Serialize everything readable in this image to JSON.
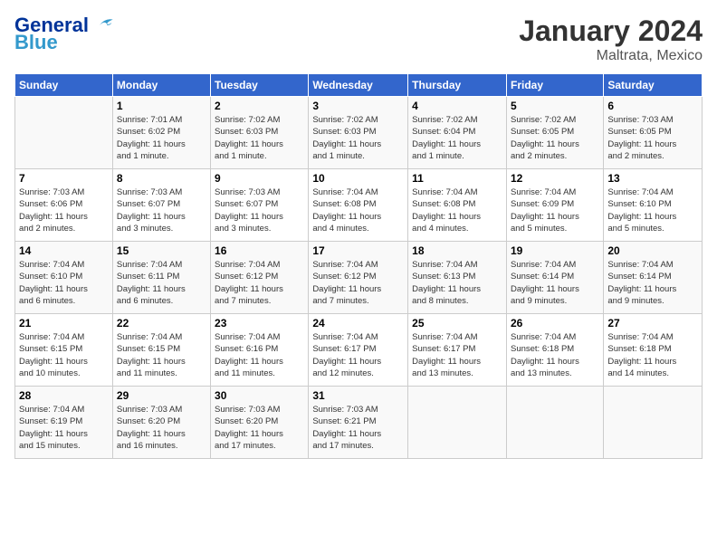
{
  "header": {
    "logo_line1": "General",
    "logo_line2": "Blue",
    "month_title": "January 2024",
    "location": "Maltrata, Mexico"
  },
  "weekdays": [
    "Sunday",
    "Monday",
    "Tuesday",
    "Wednesday",
    "Thursday",
    "Friday",
    "Saturday"
  ],
  "weeks": [
    [
      {
        "day": "",
        "info": ""
      },
      {
        "day": "1",
        "info": "Sunrise: 7:01 AM\nSunset: 6:02 PM\nDaylight: 11 hours\nand 1 minute."
      },
      {
        "day": "2",
        "info": "Sunrise: 7:02 AM\nSunset: 6:03 PM\nDaylight: 11 hours\nand 1 minute."
      },
      {
        "day": "3",
        "info": "Sunrise: 7:02 AM\nSunset: 6:03 PM\nDaylight: 11 hours\nand 1 minute."
      },
      {
        "day": "4",
        "info": "Sunrise: 7:02 AM\nSunset: 6:04 PM\nDaylight: 11 hours\nand 1 minute."
      },
      {
        "day": "5",
        "info": "Sunrise: 7:02 AM\nSunset: 6:05 PM\nDaylight: 11 hours\nand 2 minutes."
      },
      {
        "day": "6",
        "info": "Sunrise: 7:03 AM\nSunset: 6:05 PM\nDaylight: 11 hours\nand 2 minutes."
      }
    ],
    [
      {
        "day": "7",
        "info": "Sunrise: 7:03 AM\nSunset: 6:06 PM\nDaylight: 11 hours\nand 2 minutes."
      },
      {
        "day": "8",
        "info": "Sunrise: 7:03 AM\nSunset: 6:07 PM\nDaylight: 11 hours\nand 3 minutes."
      },
      {
        "day": "9",
        "info": "Sunrise: 7:03 AM\nSunset: 6:07 PM\nDaylight: 11 hours\nand 3 minutes."
      },
      {
        "day": "10",
        "info": "Sunrise: 7:04 AM\nSunset: 6:08 PM\nDaylight: 11 hours\nand 4 minutes."
      },
      {
        "day": "11",
        "info": "Sunrise: 7:04 AM\nSunset: 6:08 PM\nDaylight: 11 hours\nand 4 minutes."
      },
      {
        "day": "12",
        "info": "Sunrise: 7:04 AM\nSunset: 6:09 PM\nDaylight: 11 hours\nand 5 minutes."
      },
      {
        "day": "13",
        "info": "Sunrise: 7:04 AM\nSunset: 6:10 PM\nDaylight: 11 hours\nand 5 minutes."
      }
    ],
    [
      {
        "day": "14",
        "info": "Sunrise: 7:04 AM\nSunset: 6:10 PM\nDaylight: 11 hours\nand 6 minutes."
      },
      {
        "day": "15",
        "info": "Sunrise: 7:04 AM\nSunset: 6:11 PM\nDaylight: 11 hours\nand 6 minutes."
      },
      {
        "day": "16",
        "info": "Sunrise: 7:04 AM\nSunset: 6:12 PM\nDaylight: 11 hours\nand 7 minutes."
      },
      {
        "day": "17",
        "info": "Sunrise: 7:04 AM\nSunset: 6:12 PM\nDaylight: 11 hours\nand 7 minutes."
      },
      {
        "day": "18",
        "info": "Sunrise: 7:04 AM\nSunset: 6:13 PM\nDaylight: 11 hours\nand 8 minutes."
      },
      {
        "day": "19",
        "info": "Sunrise: 7:04 AM\nSunset: 6:14 PM\nDaylight: 11 hours\nand 9 minutes."
      },
      {
        "day": "20",
        "info": "Sunrise: 7:04 AM\nSunset: 6:14 PM\nDaylight: 11 hours\nand 9 minutes."
      }
    ],
    [
      {
        "day": "21",
        "info": "Sunrise: 7:04 AM\nSunset: 6:15 PM\nDaylight: 11 hours\nand 10 minutes."
      },
      {
        "day": "22",
        "info": "Sunrise: 7:04 AM\nSunset: 6:15 PM\nDaylight: 11 hours\nand 11 minutes."
      },
      {
        "day": "23",
        "info": "Sunrise: 7:04 AM\nSunset: 6:16 PM\nDaylight: 11 hours\nand 11 minutes."
      },
      {
        "day": "24",
        "info": "Sunrise: 7:04 AM\nSunset: 6:17 PM\nDaylight: 11 hours\nand 12 minutes."
      },
      {
        "day": "25",
        "info": "Sunrise: 7:04 AM\nSunset: 6:17 PM\nDaylight: 11 hours\nand 13 minutes."
      },
      {
        "day": "26",
        "info": "Sunrise: 7:04 AM\nSunset: 6:18 PM\nDaylight: 11 hours\nand 13 minutes."
      },
      {
        "day": "27",
        "info": "Sunrise: 7:04 AM\nSunset: 6:18 PM\nDaylight: 11 hours\nand 14 minutes."
      }
    ],
    [
      {
        "day": "28",
        "info": "Sunrise: 7:04 AM\nSunset: 6:19 PM\nDaylight: 11 hours\nand 15 minutes."
      },
      {
        "day": "29",
        "info": "Sunrise: 7:03 AM\nSunset: 6:20 PM\nDaylight: 11 hours\nand 16 minutes."
      },
      {
        "day": "30",
        "info": "Sunrise: 7:03 AM\nSunset: 6:20 PM\nDaylight: 11 hours\nand 17 minutes."
      },
      {
        "day": "31",
        "info": "Sunrise: 7:03 AM\nSunset: 6:21 PM\nDaylight: 11 hours\nand 17 minutes."
      },
      {
        "day": "",
        "info": ""
      },
      {
        "day": "",
        "info": ""
      },
      {
        "day": "",
        "info": ""
      }
    ]
  ]
}
